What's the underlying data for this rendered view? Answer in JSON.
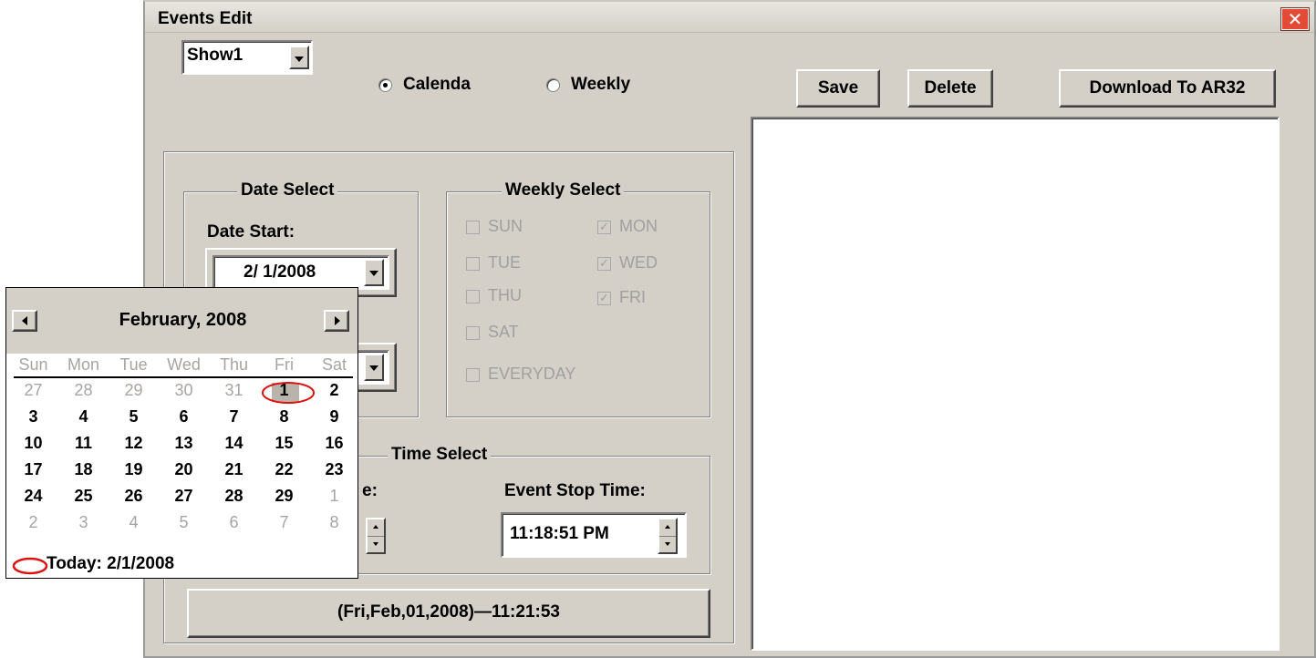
{
  "window": {
    "title": "Events Edit"
  },
  "show_select": {
    "value": "Show1"
  },
  "mode": {
    "calendar_label": "Calenda",
    "weekly_label": "Weekly",
    "selected": "calendar"
  },
  "toolbar": {
    "save_label": "Save",
    "delete_label": "Delete",
    "download_label": "Download To AR32"
  },
  "date_select": {
    "title": "Date Select",
    "start_label": "Date Start:",
    "start_value": "2/ 1/2008"
  },
  "weekly_select": {
    "title": "Weekly Select",
    "days": [
      {
        "label": "SUN",
        "checked": false
      },
      {
        "label": "MON",
        "checked": true
      },
      {
        "label": "TUE",
        "checked": false
      },
      {
        "label": "WED",
        "checked": true
      },
      {
        "label": "THU",
        "checked": false
      },
      {
        "label": "FRI",
        "checked": true
      },
      {
        "label": "SAT",
        "checked": false
      }
    ],
    "everyday_label": "EVERYDAY"
  },
  "time_select": {
    "title": "Time Select",
    "start_label_partial": "e:",
    "stop_label": "Event Stop Time:",
    "stop_value": "11:18:51 PM"
  },
  "status_text": "(Fri,Feb,01,2008)—11:21:53",
  "calendar": {
    "month_label": "February, 2008",
    "weekdays": [
      "Sun",
      "Mon",
      "Tue",
      "Wed",
      "Thu",
      "Fri",
      "Sat"
    ],
    "weeks": [
      [
        "27",
        "28",
        "29",
        "30",
        "31",
        "1",
        "2"
      ],
      [
        "3",
        "4",
        "5",
        "6",
        "7",
        "8",
        "9"
      ],
      [
        "10",
        "11",
        "12",
        "13",
        "14",
        "15",
        "16"
      ],
      [
        "17",
        "18",
        "19",
        "20",
        "21",
        "22",
        "23"
      ],
      [
        "24",
        "25",
        "26",
        "27",
        "28",
        "29",
        "1"
      ],
      [
        "2",
        "3",
        "4",
        "5",
        "6",
        "7",
        "8"
      ]
    ],
    "today_label": "Today: 2/1/2008",
    "highlight_color": "#e01010"
  }
}
